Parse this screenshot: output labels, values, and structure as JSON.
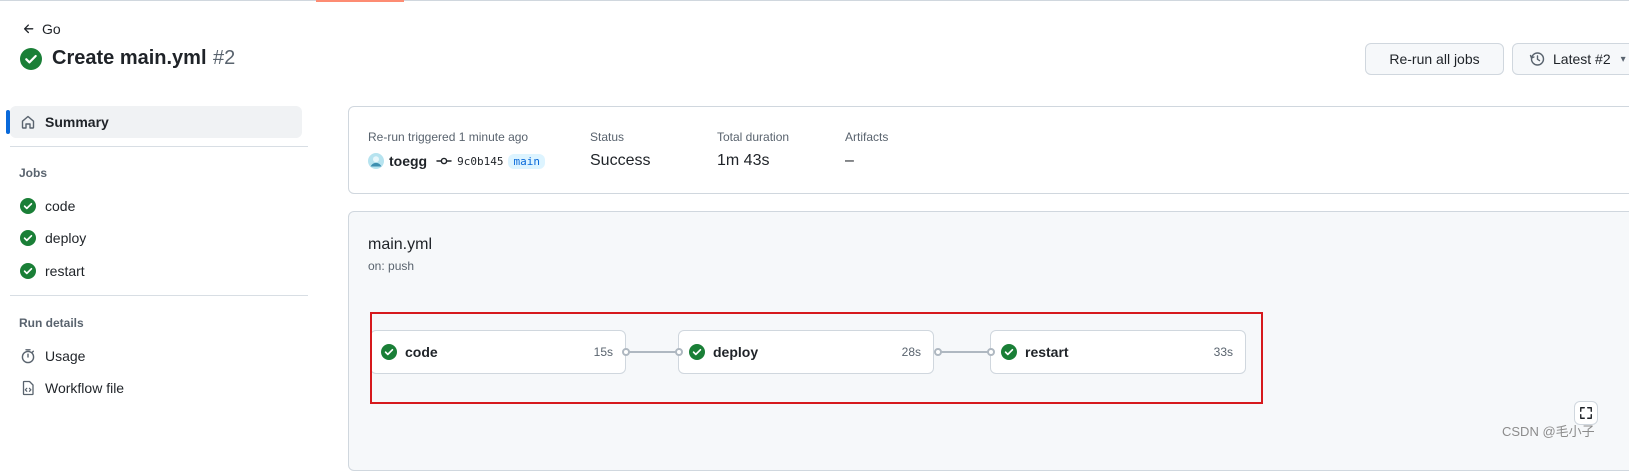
{
  "header": {
    "back_label": "Go",
    "title": "Create main.yml",
    "run_number": "#2",
    "rerun_button": "Re-run all jobs",
    "attempt_button": "Latest #2"
  },
  "sidebar": {
    "summary": "Summary",
    "jobs_heading": "Jobs",
    "jobs": [
      {
        "label": "code"
      },
      {
        "label": "deploy"
      },
      {
        "label": "restart"
      }
    ],
    "run_details_heading": "Run details",
    "usage": "Usage",
    "workflow_file": "Workflow file"
  },
  "summary_card": {
    "trigger_label": "Re-run triggered",
    "trigger_time": "1 minute ago",
    "user": "toegg",
    "commit": "9c0b145",
    "branch": "main",
    "status_label": "Status",
    "status_value": "Success",
    "duration_label": "Total duration",
    "duration_value": "1m 43s",
    "artifacts_label": "Artifacts",
    "artifacts_value": "–"
  },
  "workflow": {
    "name": "main.yml",
    "trigger": "on: push",
    "jobs": [
      {
        "name": "code",
        "duration": "15s"
      },
      {
        "name": "deploy",
        "duration": "28s"
      },
      {
        "name": "restart",
        "duration": "33s"
      }
    ]
  },
  "watermark": "CSDN @毛小子",
  "colors": {
    "success": "#1a7f37",
    "accent": "#0969da",
    "highlight": "#d6191d"
  }
}
